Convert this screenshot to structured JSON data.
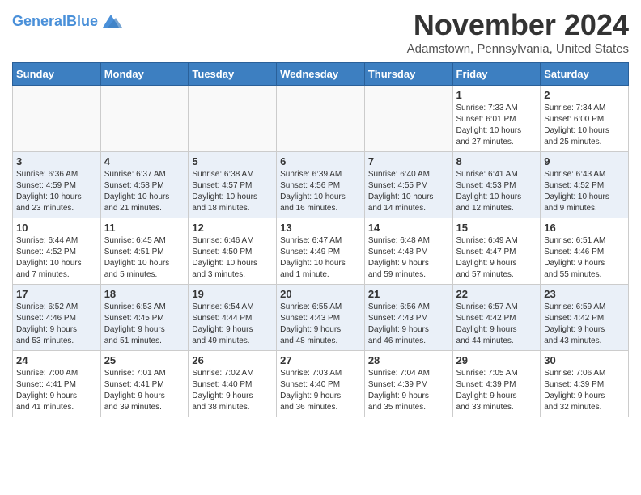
{
  "header": {
    "logo_general": "General",
    "logo_blue": "Blue",
    "month": "November 2024",
    "location": "Adamstown, Pennsylvania, United States"
  },
  "weekdays": [
    "Sunday",
    "Monday",
    "Tuesday",
    "Wednesday",
    "Thursday",
    "Friday",
    "Saturday"
  ],
  "weeks": [
    [
      {
        "day": "",
        "info": ""
      },
      {
        "day": "",
        "info": ""
      },
      {
        "day": "",
        "info": ""
      },
      {
        "day": "",
        "info": ""
      },
      {
        "day": "",
        "info": ""
      },
      {
        "day": "1",
        "info": "Sunrise: 7:33 AM\nSunset: 6:01 PM\nDaylight: 10 hours\nand 27 minutes."
      },
      {
        "day": "2",
        "info": "Sunrise: 7:34 AM\nSunset: 6:00 PM\nDaylight: 10 hours\nand 25 minutes."
      }
    ],
    [
      {
        "day": "3",
        "info": "Sunrise: 6:36 AM\nSunset: 4:59 PM\nDaylight: 10 hours\nand 23 minutes."
      },
      {
        "day": "4",
        "info": "Sunrise: 6:37 AM\nSunset: 4:58 PM\nDaylight: 10 hours\nand 21 minutes."
      },
      {
        "day": "5",
        "info": "Sunrise: 6:38 AM\nSunset: 4:57 PM\nDaylight: 10 hours\nand 18 minutes."
      },
      {
        "day": "6",
        "info": "Sunrise: 6:39 AM\nSunset: 4:56 PM\nDaylight: 10 hours\nand 16 minutes."
      },
      {
        "day": "7",
        "info": "Sunrise: 6:40 AM\nSunset: 4:55 PM\nDaylight: 10 hours\nand 14 minutes."
      },
      {
        "day": "8",
        "info": "Sunrise: 6:41 AM\nSunset: 4:53 PM\nDaylight: 10 hours\nand 12 minutes."
      },
      {
        "day": "9",
        "info": "Sunrise: 6:43 AM\nSunset: 4:52 PM\nDaylight: 10 hours\nand 9 minutes."
      }
    ],
    [
      {
        "day": "10",
        "info": "Sunrise: 6:44 AM\nSunset: 4:52 PM\nDaylight: 10 hours\nand 7 minutes."
      },
      {
        "day": "11",
        "info": "Sunrise: 6:45 AM\nSunset: 4:51 PM\nDaylight: 10 hours\nand 5 minutes."
      },
      {
        "day": "12",
        "info": "Sunrise: 6:46 AM\nSunset: 4:50 PM\nDaylight: 10 hours\nand 3 minutes."
      },
      {
        "day": "13",
        "info": "Sunrise: 6:47 AM\nSunset: 4:49 PM\nDaylight: 10 hours\nand 1 minute."
      },
      {
        "day": "14",
        "info": "Sunrise: 6:48 AM\nSunset: 4:48 PM\nDaylight: 9 hours\nand 59 minutes."
      },
      {
        "day": "15",
        "info": "Sunrise: 6:49 AM\nSunset: 4:47 PM\nDaylight: 9 hours\nand 57 minutes."
      },
      {
        "day": "16",
        "info": "Sunrise: 6:51 AM\nSunset: 4:46 PM\nDaylight: 9 hours\nand 55 minutes."
      }
    ],
    [
      {
        "day": "17",
        "info": "Sunrise: 6:52 AM\nSunset: 4:46 PM\nDaylight: 9 hours\nand 53 minutes."
      },
      {
        "day": "18",
        "info": "Sunrise: 6:53 AM\nSunset: 4:45 PM\nDaylight: 9 hours\nand 51 minutes."
      },
      {
        "day": "19",
        "info": "Sunrise: 6:54 AM\nSunset: 4:44 PM\nDaylight: 9 hours\nand 49 minutes."
      },
      {
        "day": "20",
        "info": "Sunrise: 6:55 AM\nSunset: 4:43 PM\nDaylight: 9 hours\nand 48 minutes."
      },
      {
        "day": "21",
        "info": "Sunrise: 6:56 AM\nSunset: 4:43 PM\nDaylight: 9 hours\nand 46 minutes."
      },
      {
        "day": "22",
        "info": "Sunrise: 6:57 AM\nSunset: 4:42 PM\nDaylight: 9 hours\nand 44 minutes."
      },
      {
        "day": "23",
        "info": "Sunrise: 6:59 AM\nSunset: 4:42 PM\nDaylight: 9 hours\nand 43 minutes."
      }
    ],
    [
      {
        "day": "24",
        "info": "Sunrise: 7:00 AM\nSunset: 4:41 PM\nDaylight: 9 hours\nand 41 minutes."
      },
      {
        "day": "25",
        "info": "Sunrise: 7:01 AM\nSunset: 4:41 PM\nDaylight: 9 hours\nand 39 minutes."
      },
      {
        "day": "26",
        "info": "Sunrise: 7:02 AM\nSunset: 4:40 PM\nDaylight: 9 hours\nand 38 minutes."
      },
      {
        "day": "27",
        "info": "Sunrise: 7:03 AM\nSunset: 4:40 PM\nDaylight: 9 hours\nand 36 minutes."
      },
      {
        "day": "28",
        "info": "Sunrise: 7:04 AM\nSunset: 4:39 PM\nDaylight: 9 hours\nand 35 minutes."
      },
      {
        "day": "29",
        "info": "Sunrise: 7:05 AM\nSunset: 4:39 PM\nDaylight: 9 hours\nand 33 minutes."
      },
      {
        "day": "30",
        "info": "Sunrise: 7:06 AM\nSunset: 4:39 PM\nDaylight: 9 hours\nand 32 minutes."
      }
    ]
  ],
  "alt_rows": [
    1,
    3
  ]
}
